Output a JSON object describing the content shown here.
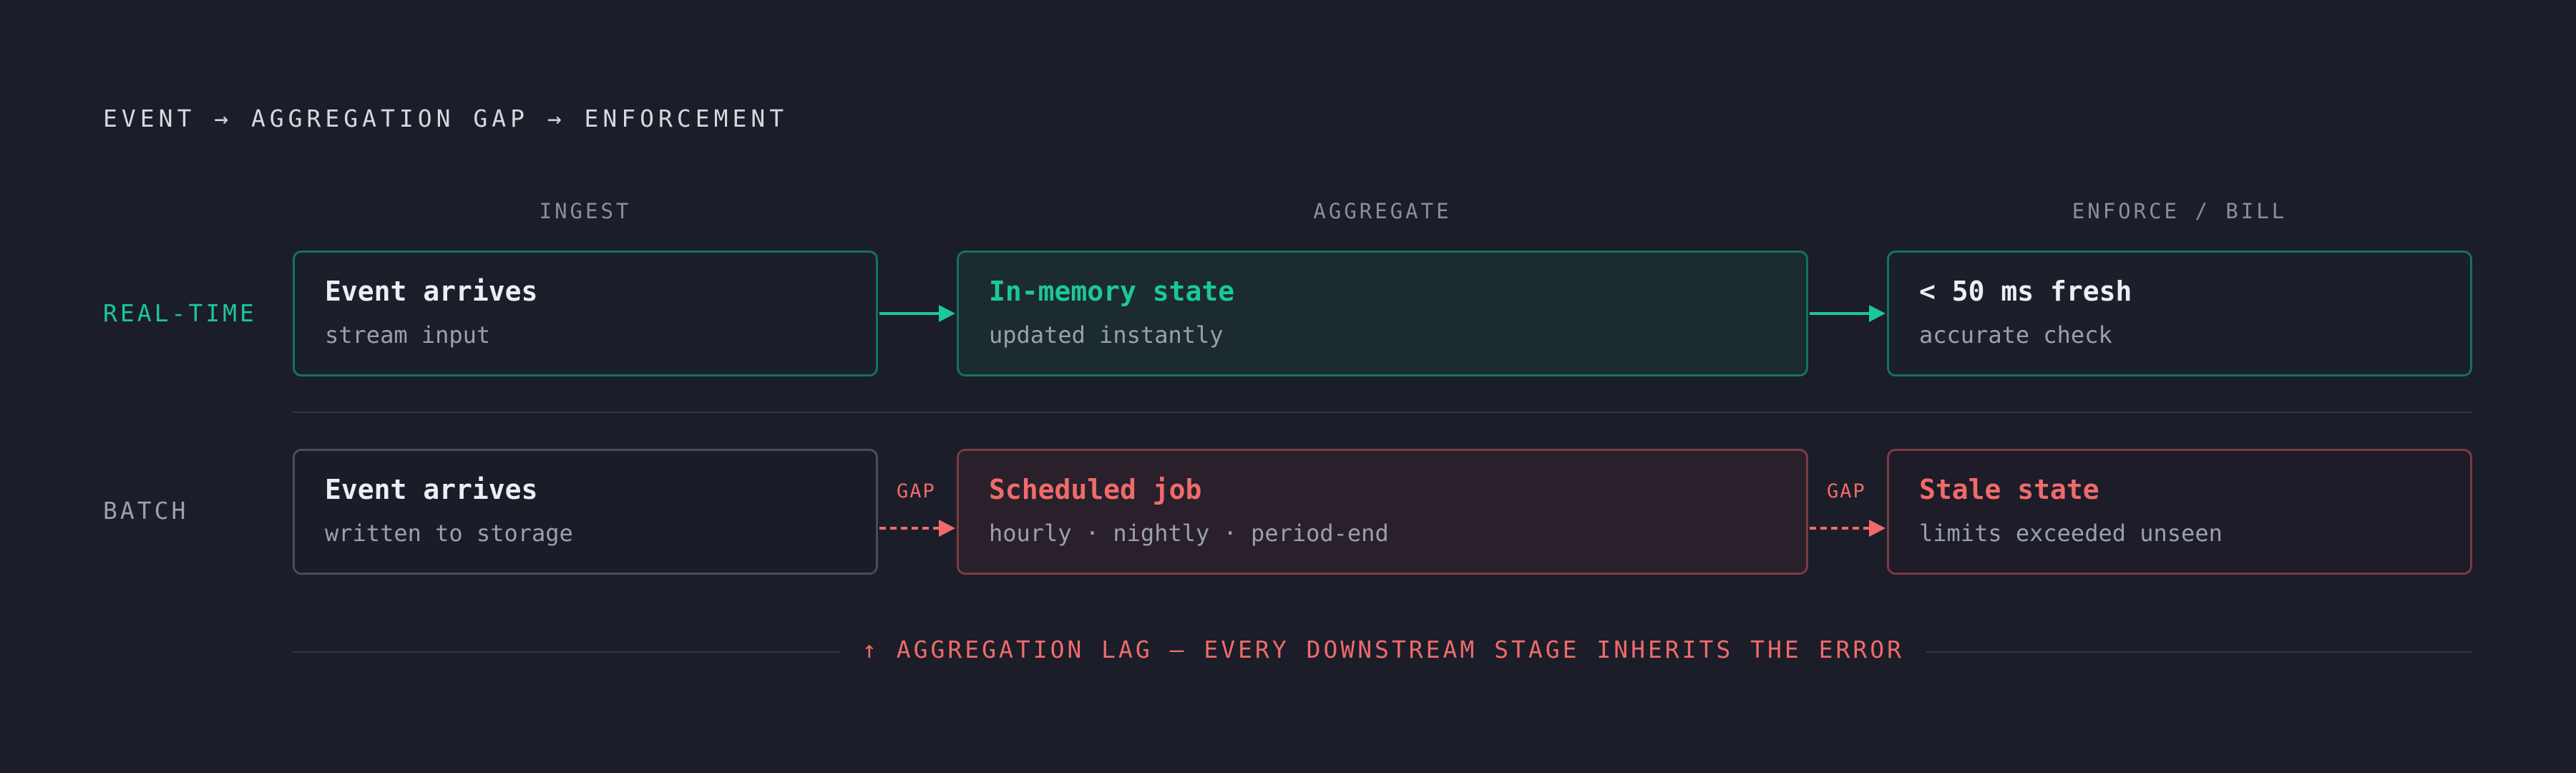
{
  "title": "EVENT → AGGREGATION GAP → ENFORCEMENT",
  "columns": [
    "INGEST",
    "AGGREGATE",
    "ENFORCE / BILL"
  ],
  "rows": {
    "realtime": {
      "label": "REAL-TIME",
      "stages": [
        {
          "title": "Event arrives",
          "subtitle": "stream input"
        },
        {
          "title": "In-memory state",
          "subtitle": "updated instantly"
        },
        {
          "title": "< 50 ms fresh",
          "subtitle": "accurate check"
        }
      ]
    },
    "batch": {
      "label": "BATCH",
      "gap_label": "GAP",
      "stages": [
        {
          "title": "Event arrives",
          "subtitle": "written to storage"
        },
        {
          "title": "Scheduled job",
          "subtitle": "hourly · nightly · period-end"
        },
        {
          "title": "Stale state",
          "subtitle": "limits exceeded unseen"
        }
      ]
    }
  },
  "footer": "↑ AGGREGATION LAG — EVERY DOWNSTREAM STAGE INHERITS THE ERROR",
  "colors": {
    "green": "#1cc79a",
    "red": "#ef6b6b",
    "background": "#1b1d29",
    "white": "#eceef3",
    "muted": "#9aa0ad"
  }
}
